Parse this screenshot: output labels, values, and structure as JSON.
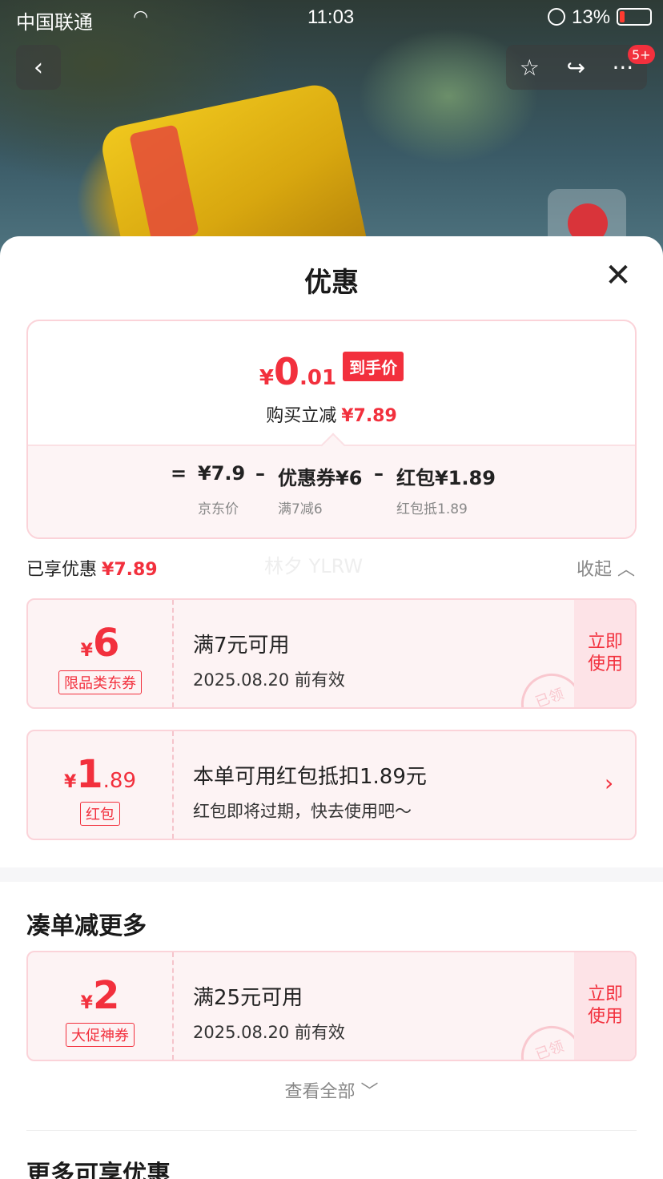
{
  "status_bar": {
    "carrier": "中国联通",
    "time": "11:03",
    "battery": "13%"
  },
  "nav": {
    "badge": "5+"
  },
  "sheet": {
    "title": "优惠"
  },
  "summary": {
    "currency": "¥",
    "price_int": "0",
    "price_dec": ".01",
    "price_tag": "到手价",
    "reduce_label": "购买立减",
    "reduce_amount": "¥7.89",
    "formula": {
      "equals": "=",
      "jd_price": "¥7.9",
      "minus1": "–",
      "coupon": "优惠券¥6",
      "minus2": "–",
      "redpacket": "红包¥1.89",
      "jd_price_label": "京东价",
      "coupon_label": "满7减6",
      "redpacket_label": "红包抵1.89"
    }
  },
  "enjoyed": {
    "label": "已享优惠",
    "amount": "¥7.89",
    "collapse": "收起",
    "watermark": "林夕 YLRW"
  },
  "coupons": [
    {
      "currency": "¥",
      "value": "6",
      "decimal": "",
      "kind": "限品类东券",
      "main": "满7元可用",
      "sub": "2025.08.20 前有效",
      "action": [
        "立即",
        "使用"
      ],
      "stamp": "已领"
    },
    {
      "currency": "¥",
      "value": "1",
      "decimal": ".89",
      "kind": "红包",
      "main": "本单可用红包抵扣1.89元",
      "sub": "红包即将过期，快去使用吧～"
    }
  ],
  "more_section": {
    "title": "凑单减更多",
    "coupon": {
      "currency": "¥",
      "value": "2",
      "kind": "大促神券",
      "main": "满25元可用",
      "sub": "2025.08.20 前有效",
      "action": [
        "立即",
        "使用"
      ],
      "stamp": "已领"
    },
    "view_all": "查看全部"
  },
  "extra_section": {
    "title": "更多可享优惠"
  },
  "colors": {
    "accent": "#f2303d",
    "card_bg": "#fdf3f4",
    "card_border": "#fbd3d9"
  }
}
